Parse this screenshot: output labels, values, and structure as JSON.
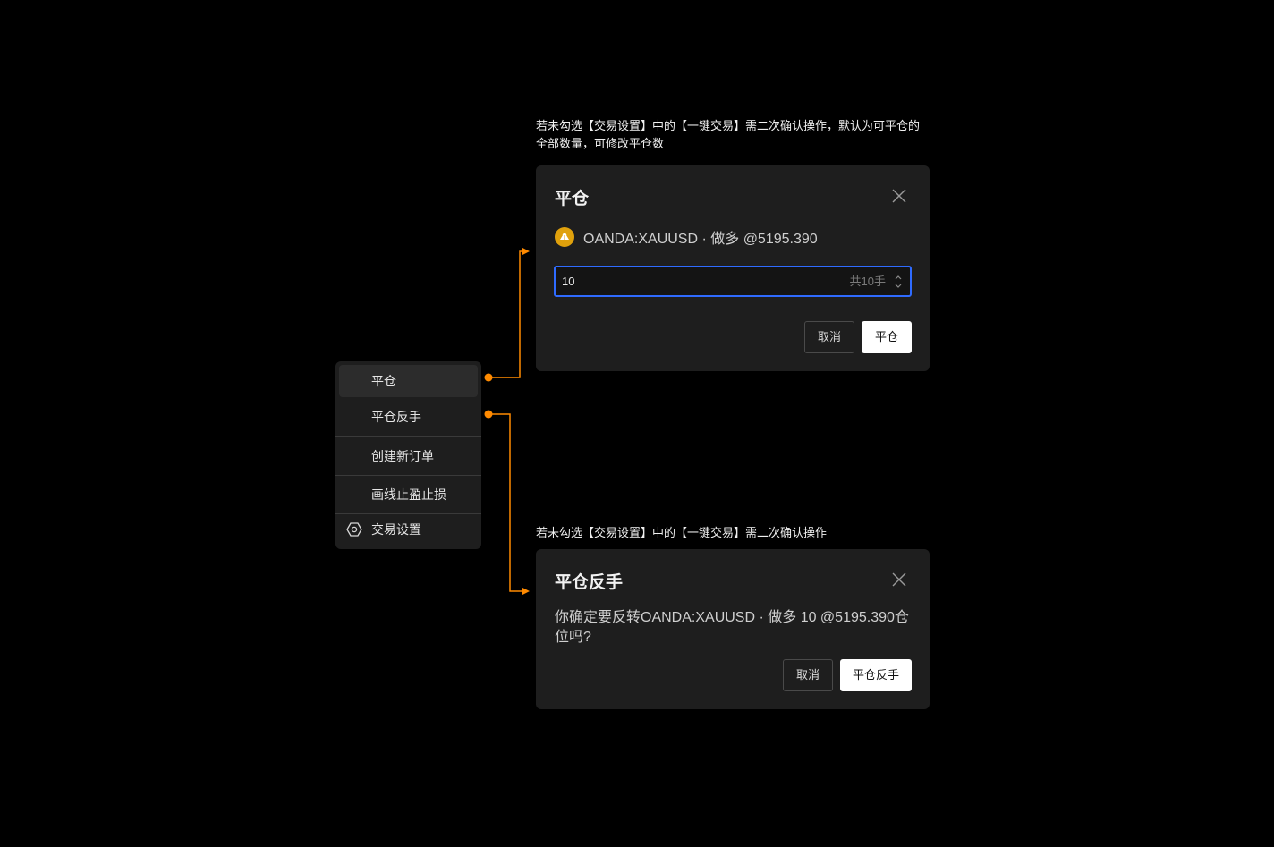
{
  "menu": {
    "items": [
      {
        "label": "平仓"
      },
      {
        "label": "平仓反手"
      },
      {
        "label": "创建新订单"
      },
      {
        "label": "画线止盈止损"
      },
      {
        "label": "交易设置"
      }
    ],
    "settings_icon": "gear-icon"
  },
  "colors": {
    "background": "#000000",
    "panel": "#1e1e1e",
    "connector": "#ff8a00",
    "focus_border": "#2f6bff",
    "gold_logo": "#e0a10c"
  },
  "close_dialog": {
    "note": "若未勾选【交易设置】中的【一键交易】需二次确认操作，默认为可平仓的全部数量，可修改平仓数",
    "title": "平仓",
    "instrument": "OANDA:XAUUSD · 做多 @5195.390",
    "quantity_value": "10",
    "quantity_suffix": "共10手",
    "cancel_label": "取消",
    "confirm_label": "平仓"
  },
  "reverse_dialog": {
    "note": "若未勾选【交易设置】中的【一键交易】需二次确认操作",
    "title": "平仓反手",
    "message": "你确定要反转OANDA:XAUUSD · 做多 10 @5195.390仓位吗?",
    "cancel_label": "取消",
    "confirm_label": "平仓反手"
  }
}
